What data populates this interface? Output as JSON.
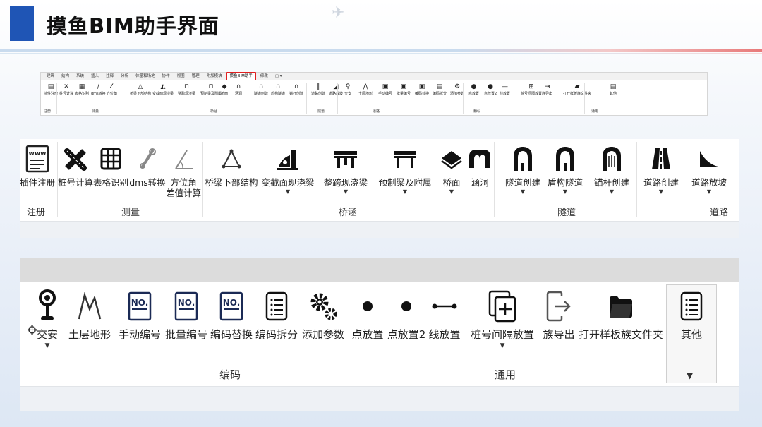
{
  "slide": {
    "title": "摸鱼BIM助手界面"
  },
  "mini": {
    "tabs": [
      "建筑",
      "结构",
      "系统",
      "插入",
      "注释",
      "分析",
      "体量和场地",
      "协作",
      "视图",
      "管理",
      "附加模块",
      "摸鱼BIM助手",
      "修改",
      "▢ ▾"
    ],
    "active_tab": "摸鱼BIM助手",
    "items": [
      {
        "label": "插件注册",
        "icon": "▤"
      },
      {
        "label": "桩号计算",
        "icon": "✕"
      },
      {
        "label": "表格识别",
        "icon": "▦"
      },
      {
        "label": "dms转换",
        "icon": "∕"
      },
      {
        "label": "方位角",
        "icon": "∠"
      },
      {
        "label": "桥梁下部结构",
        "icon": "△"
      },
      {
        "label": "变截面现浇梁",
        "icon": "◭"
      },
      {
        "label": "整跨现浇梁",
        "icon": "⊓"
      },
      {
        "label": "预制梁及附属",
        "icon": "⊓"
      },
      {
        "label": "桥面",
        "icon": "◆"
      },
      {
        "label": "涵洞",
        "icon": "∩"
      },
      {
        "label": "隧道创建",
        "icon": "∩"
      },
      {
        "label": "盾构隧道",
        "icon": "∩"
      },
      {
        "label": "锚杆创建",
        "icon": "∩"
      },
      {
        "label": "道路创建",
        "icon": "‖"
      },
      {
        "label": "道路放坡",
        "icon": "◢"
      },
      {
        "label": "交安",
        "icon": "♀"
      },
      {
        "label": "土层地形",
        "icon": "⋀"
      },
      {
        "label": "手动编号",
        "icon": "▣"
      },
      {
        "label": "批量编号",
        "icon": "▣"
      },
      {
        "label": "编码替换",
        "icon": "▣"
      },
      {
        "label": "编码拆分",
        "icon": "▤"
      },
      {
        "label": "添加参数",
        "icon": "⚙"
      },
      {
        "label": "点放置",
        "icon": "●"
      },
      {
        "label": "点放置2",
        "icon": "●"
      },
      {
        "label": "线放置",
        "icon": "—"
      },
      {
        "label": "桩号间隔放置",
        "icon": "⊞"
      },
      {
        "label": "族导出",
        "icon": "⇥"
      },
      {
        "label": "打开样板族文件夹",
        "icon": "▰"
      },
      {
        "label": "其他",
        "icon": "▤"
      }
    ],
    "groups": [
      "注册",
      "测量",
      "桥涵",
      "隧道",
      "道路",
      "编码",
      "通用"
    ]
  },
  "ribbon1": {
    "items": [
      {
        "label": "插件注册"
      },
      {
        "label": "桩号计算"
      },
      {
        "label": "表格识别"
      },
      {
        "label": "dms转换"
      },
      {
        "label": "方位角\n差值计算"
      },
      {
        "label": "桥梁下部结构"
      },
      {
        "label": "变截面现浇梁"
      },
      {
        "label": "整跨现浇梁"
      },
      {
        "label": "预制梁及附属"
      },
      {
        "label": "桥面"
      },
      {
        "label": "涵洞"
      },
      {
        "label": "隧道创建"
      },
      {
        "label": "盾构隧道"
      },
      {
        "label": "锚杆创建"
      },
      {
        "label": "道路创建"
      },
      {
        "label": "道路放坡"
      }
    ],
    "groups": {
      "register": "注册",
      "measure": "测量",
      "bridge": "桥涵",
      "tunnel": "隧道",
      "road": "道路"
    },
    "icon_text": "www"
  },
  "ribbon2": {
    "items": [
      {
        "label": "交安"
      },
      {
        "label": "土层地形"
      },
      {
        "label": "手动编号"
      },
      {
        "label": "批量编号"
      },
      {
        "label": "编码替换"
      },
      {
        "label": "编码拆分"
      },
      {
        "label": "添加参数"
      },
      {
        "label": "点放置"
      },
      {
        "label": "点放置2"
      },
      {
        "label": "线放置"
      },
      {
        "label": "桩号间隔放置"
      },
      {
        "label": "族导出"
      },
      {
        "label": "打开样板族文件夹"
      },
      {
        "label": "其他"
      }
    ],
    "groups": {
      "code": "编码",
      "general": "通用"
    },
    "no_text": "NO."
  }
}
